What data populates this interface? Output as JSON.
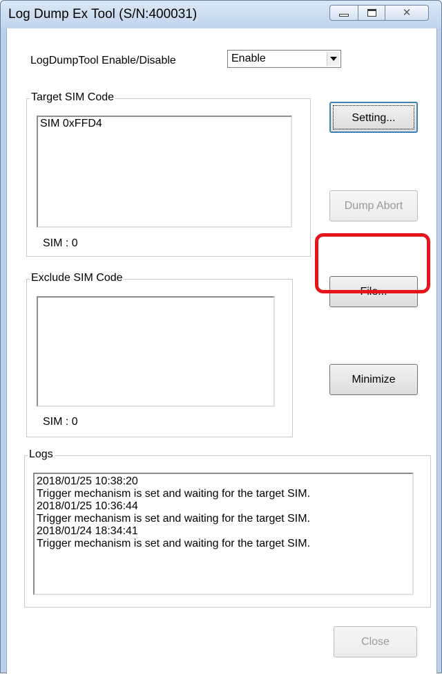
{
  "window": {
    "title": "Log Dump Ex Tool (S/N:400031)",
    "close_glyph": "✕"
  },
  "enable": {
    "label": "LogDumpTool Enable/Disable",
    "selected": "Enable"
  },
  "target": {
    "legend": "Target SIM Code",
    "items": [
      "SIM 0xFFD4"
    ],
    "count_label": "SIM : 0"
  },
  "exclude": {
    "legend": "Exclude SIM Code",
    "items": [],
    "count_label": "SIM : 0"
  },
  "logs": {
    "legend": "Logs",
    "lines": [
      "2018/01/25 10:38:20",
      "Trigger mechanism is set and waiting for the target SIM.",
      "2018/01/25 10:36:44",
      "Trigger mechanism is set and waiting for the target SIM.",
      "2018/01/24 18:34:41",
      "Trigger mechanism is set and waiting for the target SIM."
    ]
  },
  "buttons": {
    "setting": "Setting...",
    "dump_abort": "Dump Abort",
    "file": "File...",
    "minimize": "Minimize",
    "close": "Close"
  },
  "colors": {
    "highlight": "#e8141c",
    "titlebar": "#bfd4ec"
  }
}
